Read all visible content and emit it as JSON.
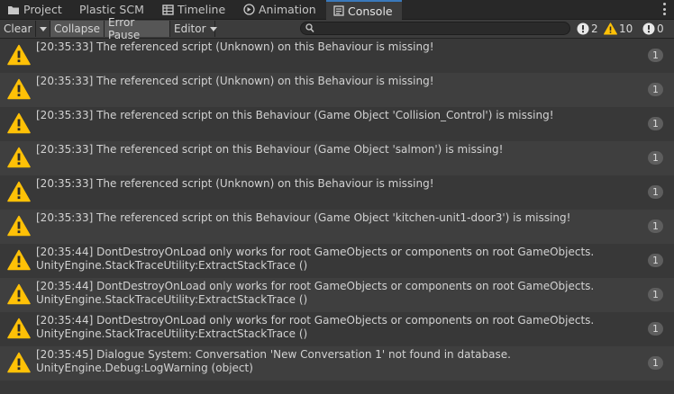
{
  "tabs": [
    {
      "label": "Project",
      "icon": "folder-icon"
    },
    {
      "label": "Plastic SCM",
      "icon": ""
    },
    {
      "label": "Timeline",
      "icon": "timeline-icon"
    },
    {
      "label": "Animation",
      "icon": "animation-icon"
    },
    {
      "label": "Console",
      "icon": "console-icon",
      "active": true
    }
  ],
  "toolbar": {
    "clear_label": "Clear",
    "collapse_label": "Collapse",
    "error_pause_label": "Error Pause",
    "editor_label": "Editor",
    "search": {
      "value": "",
      "placeholder": ""
    },
    "counts": {
      "errors": "2",
      "warnings": "10",
      "info": "0"
    }
  },
  "colors": {
    "accent": "#3a79bb",
    "warning": "#ffc107",
    "background": "#383838"
  },
  "logs": [
    {
      "line1": "[20:35:33] The referenced script (Unknown) on this Behaviour is missing!",
      "line2": "",
      "count": "1"
    },
    {
      "line1": "[20:35:33] The referenced script (Unknown) on this Behaviour is missing!",
      "line2": "",
      "count": "1"
    },
    {
      "line1": "[20:35:33] The referenced script on this Behaviour (Game Object 'Collision_Control') is missing!",
      "line2": "",
      "count": "1"
    },
    {
      "line1": "[20:35:33] The referenced script on this Behaviour (Game Object 'salmon') is missing!",
      "line2": "",
      "count": "1"
    },
    {
      "line1": "[20:35:33] The referenced script (Unknown) on this Behaviour is missing!",
      "line2": "",
      "count": "1"
    },
    {
      "line1": "[20:35:33] The referenced script on this Behaviour (Game Object 'kitchen-unit1-door3') is missing!",
      "line2": "",
      "count": "1"
    },
    {
      "line1": "[20:35:44] DontDestroyOnLoad only works for root GameObjects or components on root GameObjects.",
      "line2": "UnityEngine.StackTraceUtility:ExtractStackTrace ()",
      "count": "1"
    },
    {
      "line1": "[20:35:44] DontDestroyOnLoad only works for root GameObjects or components on root GameObjects.",
      "line2": "UnityEngine.StackTraceUtility:ExtractStackTrace ()",
      "count": "1"
    },
    {
      "line1": "[20:35:44] DontDestroyOnLoad only works for root GameObjects or components on root GameObjects.",
      "line2": "UnityEngine.StackTraceUtility:ExtractStackTrace ()",
      "count": "1"
    },
    {
      "line1": "[20:35:45] Dialogue System: Conversation 'New Conversation 1' not found in database.",
      "line2": "UnityEngine.Debug:LogWarning (object)",
      "count": "1"
    }
  ]
}
